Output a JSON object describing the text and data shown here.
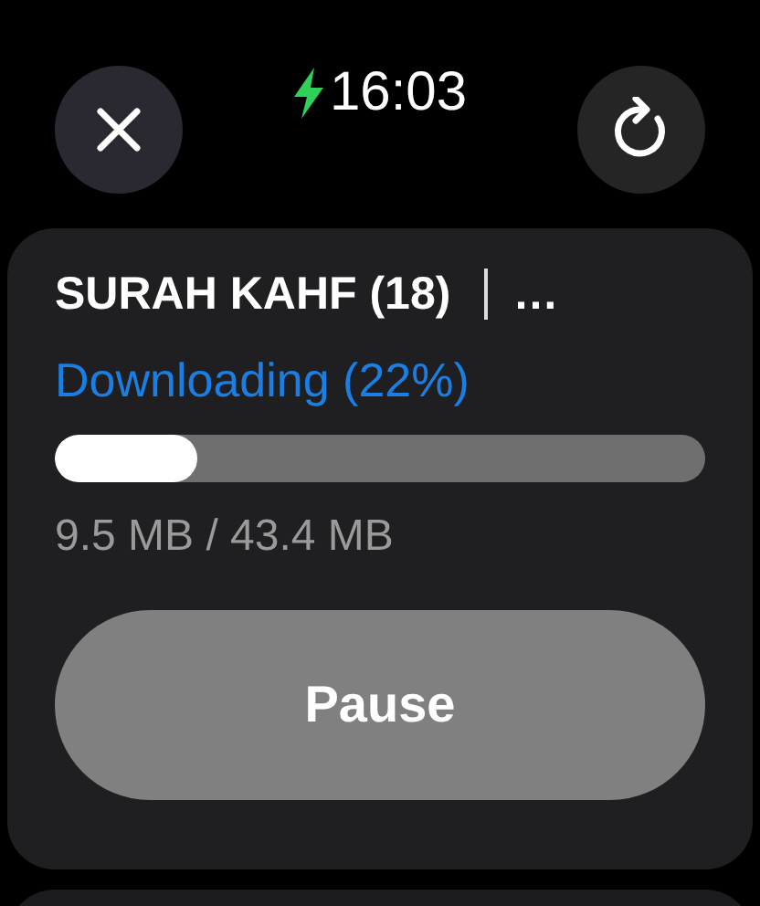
{
  "status_bar": {
    "time": "16:03",
    "charging": true
  },
  "download": {
    "title": "SURAH KAHF (18)",
    "more": "…",
    "status": "Downloading (22%)",
    "level": 0.22,
    "size": "9.5 MB / 43.4 MB",
    "button": "Pause"
  }
}
